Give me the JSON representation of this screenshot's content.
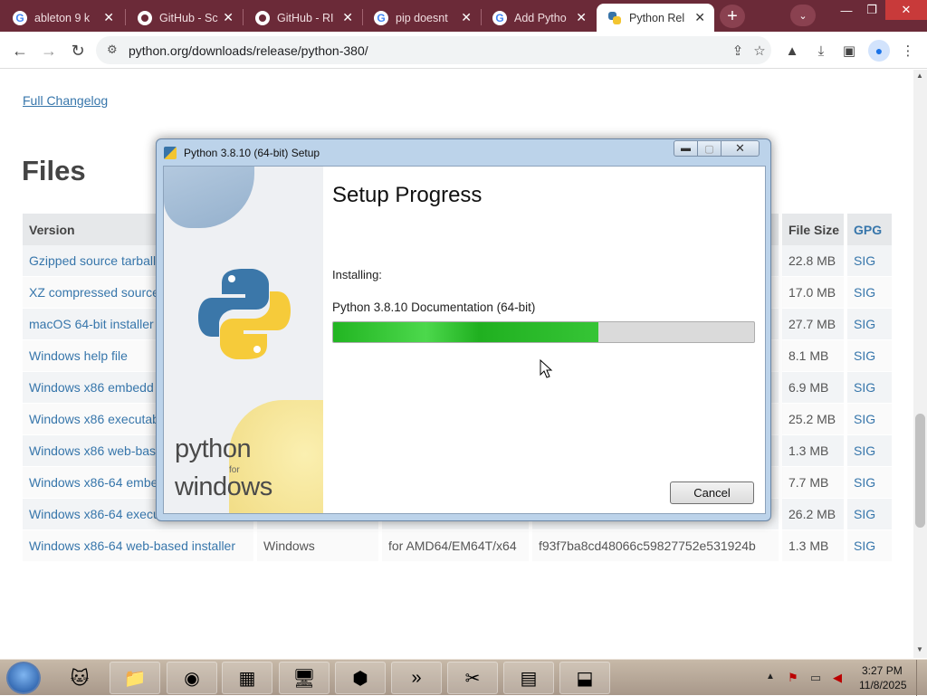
{
  "browser": {
    "tabs": [
      {
        "label": "ableton 9 k",
        "icon": "google-icon"
      },
      {
        "label": "GitHub - Sc",
        "icon": "github-icon"
      },
      {
        "label": "GitHub - RI",
        "icon": "github-icon"
      },
      {
        "label": "pip doesnt",
        "icon": "google-icon"
      },
      {
        "label": "Add Pytho",
        "icon": "google-icon"
      },
      {
        "label": "Python Rel",
        "icon": "python-icon",
        "active": true
      }
    ],
    "url": "python.org/downloads/release/python-380/"
  },
  "page": {
    "changelog_link": "Full Changelog",
    "files_heading": "Files",
    "table": {
      "headers": [
        "Version",
        "",
        "",
        "",
        "File Size",
        "GPG"
      ],
      "rows": [
        [
          "Gzipped source tarball",
          "",
          "",
          "",
          "22.8 MB",
          "SIG"
        ],
        [
          "XZ compressed source",
          "",
          "",
          "",
          "17.0 MB",
          "SIG"
        ],
        [
          "macOS 64-bit installer",
          "",
          "",
          "",
          "27.7 MB",
          "SIG"
        ],
        [
          "Windows help file",
          "",
          "",
          "",
          "8.1 MB",
          "SIG"
        ],
        [
          "Windows x86 embedd",
          "",
          "",
          "",
          "6.9 MB",
          "SIG"
        ],
        [
          "Windows x86 executab",
          "",
          "",
          "",
          "25.2 MB",
          "SIG"
        ],
        [
          "Windows x86 web-base",
          "",
          "",
          "",
          "1.3 MB",
          "SIG"
        ],
        [
          "Windows x86-64 embe",
          "",
          "",
          "",
          "7.7 MB",
          "SIG"
        ],
        [
          "Windows x86-64 execu",
          "",
          "",
          "",
          "26.2 MB",
          "SIG"
        ],
        [
          "Windows x86-64 web-based installer",
          "Windows",
          "for AMD64/EM64T/x64",
          "f93f7ba8cd48066c59827752e531924b",
          "1.3 MB",
          "SIG"
        ]
      ]
    }
  },
  "dialog": {
    "title": "Python 3.8.10 (64-bit) Setup",
    "heading": "Setup Progress",
    "status_label": "Installing:",
    "component": "Python 3.8.10 Documentation (64-bit)",
    "progress": 0.63,
    "cancel_label": "Cancel",
    "brand_word": "python",
    "brand_for": "for",
    "brand_platform": "windows"
  },
  "taskbar": {
    "time": "3:27 PM",
    "date": "11/8/2025"
  },
  "colors": {
    "tabstrip": "#6b2a38",
    "link": "#3776ab",
    "progress_green": "#22b522"
  }
}
